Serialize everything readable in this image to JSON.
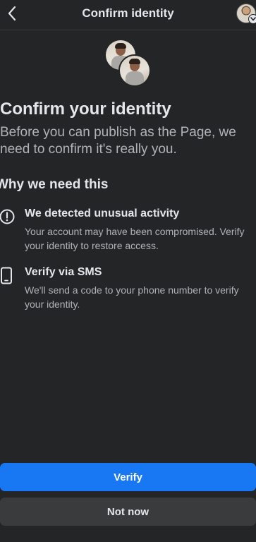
{
  "header": {
    "title": "Confirm identity",
    "back_icon": "chevron-left-icon",
    "profile_icon": "profile-switcher-icon"
  },
  "main": {
    "heading": "Confirm your identity",
    "subtitle": "Before you can publish as the Page, we need to confirm it's really you.",
    "section_title": "Why we need this",
    "items": [
      {
        "icon": "alert-circle-icon",
        "title": "We detected unusual activity",
        "description": "Your account may have been compromised. Verify your identity to restore access."
      },
      {
        "icon": "phone-icon",
        "title": "Verify via SMS",
        "description": "We'll send a code to your phone number to verify your identity."
      }
    ]
  },
  "actions": {
    "verify_label": "Verify",
    "not_now_label": "Not now"
  },
  "colors": {
    "background": "#242526",
    "primary": "#1877f2",
    "secondary_button": "#3a3b3c",
    "text_primary": "#e4e6eb",
    "text_secondary": "#b0b3b8"
  }
}
